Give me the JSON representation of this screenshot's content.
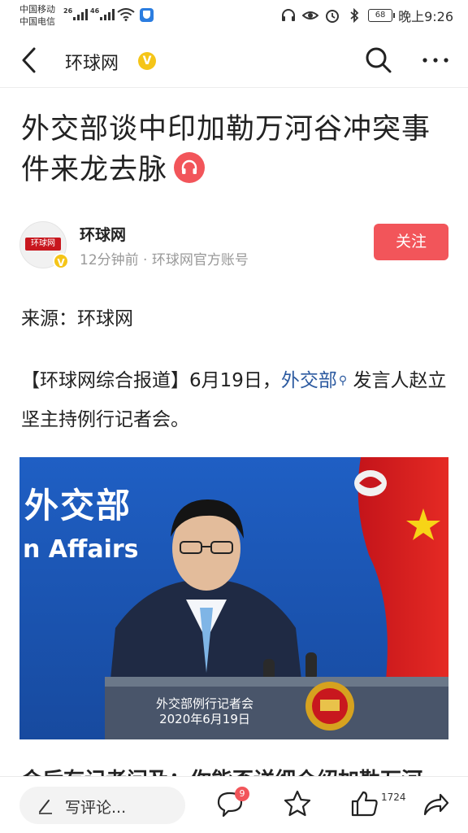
{
  "status_bar": {
    "carrier1": "中国移动",
    "carrier2": "中国电信",
    "sig1_label": "26",
    "sig2_label": "46",
    "battery": "68",
    "time": "晚上9:26"
  },
  "nav": {
    "title": "环球网",
    "verified_mark": "V"
  },
  "article": {
    "headline": "外交部谈中印加勒万河谷冲突事件来龙去脉",
    "author": "环球网",
    "author_logo": "环球网",
    "meta": "12分钟前 · 环球网官方账号",
    "follow_label": "关注",
    "source": "来源：环球网",
    "para_prefix": "【环球网综合报道】6月19日，",
    "para_link": "外交部",
    "para_suffix": " 发言人赵立坚主持例行记者会。",
    "cut_line": "会后有记者问及：你能否详细介绍加勒万河"
  },
  "photo": {
    "backdrop_cn": "外交部",
    "backdrop_en": "n Affairs",
    "podium_line1": "外交部例行记者会",
    "podium_line2": "2020年6月19日"
  },
  "bottom_bar": {
    "comment_placeholder": "写评论...",
    "comment_badge": "9",
    "like_count": "1724"
  },
  "colors": {
    "accent_red": "#f2555a",
    "link_blue": "#2c5aa0",
    "verified_gold": "#f5c518"
  }
}
